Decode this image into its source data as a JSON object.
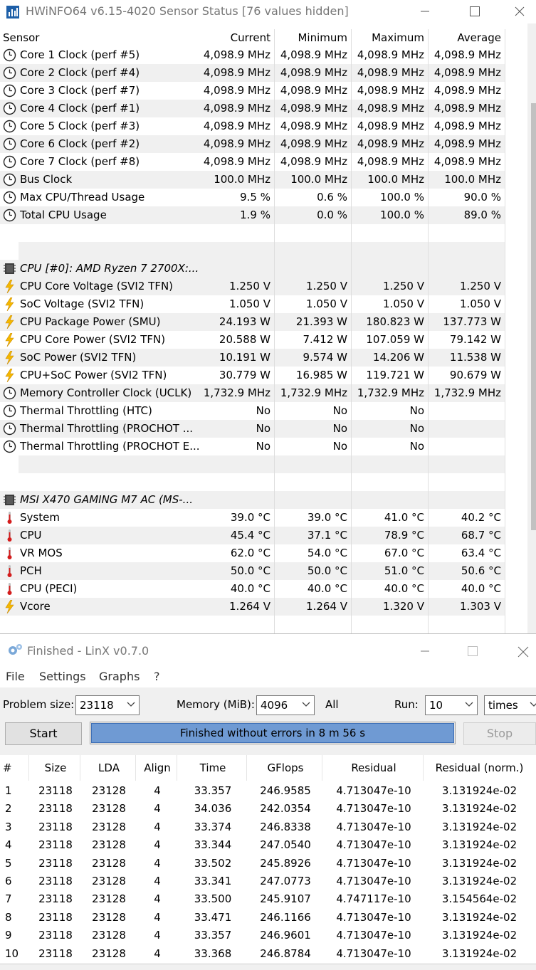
{
  "hwinfo": {
    "title": "HWiNFO64 v6.15-4020 Sensor Status [76 values hidden]",
    "columns": [
      "Sensor",
      "Current",
      "Minimum",
      "Maximum",
      "Average"
    ],
    "rows": [
      {
        "type": "sensor",
        "icon": "clock-icon",
        "label": "Core 1 Clock (perf #5)",
        "cur": "4,098.9 MHz",
        "min": "4,098.9 MHz",
        "max": "4,098.9 MHz",
        "avg": "4,098.9 MHz"
      },
      {
        "type": "sensor",
        "icon": "clock-icon",
        "label": "Core 2 Clock (perf #4)",
        "cur": "4,098.9 MHz",
        "min": "4,098.9 MHz",
        "max": "4,098.9 MHz",
        "avg": "4,098.9 MHz"
      },
      {
        "type": "sensor",
        "icon": "clock-icon",
        "label": "Core 3 Clock (perf #7)",
        "cur": "4,098.9 MHz",
        "min": "4,098.9 MHz",
        "max": "4,098.9 MHz",
        "avg": "4,098.9 MHz"
      },
      {
        "type": "sensor",
        "icon": "clock-icon",
        "label": "Core 4 Clock (perf #1)",
        "cur": "4,098.9 MHz",
        "min": "4,098.9 MHz",
        "max": "4,098.9 MHz",
        "avg": "4,098.9 MHz"
      },
      {
        "type": "sensor",
        "icon": "clock-icon",
        "label": "Core 5 Clock (perf #3)",
        "cur": "4,098.9 MHz",
        "min": "4,098.9 MHz",
        "max": "4,098.9 MHz",
        "avg": "4,098.9 MHz"
      },
      {
        "type": "sensor",
        "icon": "clock-icon",
        "label": "Core 6 Clock (perf #2)",
        "cur": "4,098.9 MHz",
        "min": "4,098.9 MHz",
        "max": "4,098.9 MHz",
        "avg": "4,098.9 MHz"
      },
      {
        "type": "sensor",
        "icon": "clock-icon",
        "label": "Core 7 Clock (perf #8)",
        "cur": "4,098.9 MHz",
        "min": "4,098.9 MHz",
        "max": "4,098.9 MHz",
        "avg": "4,098.9 MHz"
      },
      {
        "type": "sensor",
        "icon": "clock-icon",
        "label": "Bus Clock",
        "cur": "100.0 MHz",
        "min": "100.0 MHz",
        "max": "100.0 MHz",
        "avg": "100.0 MHz"
      },
      {
        "type": "sensor",
        "icon": "clock-icon",
        "label": "Max CPU/Thread Usage",
        "cur": "9.5 %",
        "min": "0.6 %",
        "max": "100.0 %",
        "avg": "90.0 %"
      },
      {
        "type": "sensor",
        "icon": "clock-icon",
        "label": "Total CPU Usage",
        "cur": "1.9 %",
        "min": "0.0 %",
        "max": "100.0 %",
        "avg": "89.0 %"
      },
      {
        "type": "blank"
      },
      {
        "type": "blank"
      },
      {
        "type": "group",
        "icon": "chip-icon",
        "label": "CPU [#0]: AMD Ryzen 7 2700X:..."
      },
      {
        "type": "sensor",
        "icon": "bolt-icon",
        "label": "CPU Core Voltage (SVI2 TFN)",
        "cur": "1.250 V",
        "min": "1.250 V",
        "max": "1.250 V",
        "avg": "1.250 V"
      },
      {
        "type": "sensor",
        "icon": "bolt-icon",
        "label": "SoC Voltage (SVI2 TFN)",
        "cur": "1.050 V",
        "min": "1.050 V",
        "max": "1.050 V",
        "avg": "1.050 V"
      },
      {
        "type": "sensor",
        "icon": "bolt-icon",
        "label": "CPU Package Power (SMU)",
        "cur": "24.193 W",
        "min": "21.393 W",
        "max": "180.823 W",
        "avg": "137.773 W"
      },
      {
        "type": "sensor",
        "icon": "bolt-icon",
        "label": "CPU Core Power (SVI2 TFN)",
        "cur": "20.588 W",
        "min": "7.412 W",
        "max": "107.059 W",
        "avg": "79.142 W"
      },
      {
        "type": "sensor",
        "icon": "bolt-icon",
        "label": "SoC Power (SVI2 TFN)",
        "cur": "10.191 W",
        "min": "9.574 W",
        "max": "14.206 W",
        "avg": "11.538 W"
      },
      {
        "type": "sensor",
        "icon": "bolt-icon",
        "label": "CPU+SoC Power (SVI2 TFN)",
        "cur": "30.779 W",
        "min": "16.985 W",
        "max": "119.721 W",
        "avg": "90.679 W"
      },
      {
        "type": "sensor",
        "icon": "clock-icon",
        "label": "Memory Controller Clock (UCLK)",
        "cur": "1,732.9 MHz",
        "min": "1,732.9 MHz",
        "max": "1,732.9 MHz",
        "avg": "1,732.9 MHz"
      },
      {
        "type": "sensor",
        "icon": "clock-icon",
        "label": "Thermal Throttling (HTC)",
        "cur": "No",
        "min": "No",
        "max": "No",
        "avg": ""
      },
      {
        "type": "sensor",
        "icon": "clock-icon",
        "label": "Thermal Throttling (PROCHOT ...",
        "cur": "No",
        "min": "No",
        "max": "No",
        "avg": ""
      },
      {
        "type": "sensor",
        "icon": "clock-icon",
        "label": "Thermal Throttling (PROCHOT E...",
        "cur": "No",
        "min": "No",
        "max": "No",
        "avg": ""
      },
      {
        "type": "blank"
      },
      {
        "type": "blank"
      },
      {
        "type": "group",
        "icon": "chip-icon",
        "label": "MSI X470 GAMING M7 AC (MS-..."
      },
      {
        "type": "sensor",
        "icon": "thermometer-icon",
        "label": "System",
        "cur": "39.0 °C",
        "min": "39.0 °C",
        "max": "41.0 °C",
        "avg": "40.2 °C"
      },
      {
        "type": "sensor",
        "icon": "thermometer-icon",
        "label": "CPU",
        "cur": "45.4 °C",
        "min": "37.1 °C",
        "max": "78.9 °C",
        "avg": "68.7 °C"
      },
      {
        "type": "sensor",
        "icon": "thermometer-icon",
        "label": "VR MOS",
        "cur": "62.0 °C",
        "min": "54.0 °C",
        "max": "67.0 °C",
        "avg": "63.4 °C"
      },
      {
        "type": "sensor",
        "icon": "thermometer-icon",
        "label": "PCH",
        "cur": "50.0 °C",
        "min": "50.0 °C",
        "max": "51.0 °C",
        "avg": "50.6 °C"
      },
      {
        "type": "sensor",
        "icon": "thermometer-icon",
        "label": "CPU (PECI)",
        "cur": "40.0 °C",
        "min": "40.0 °C",
        "max": "40.0 °C",
        "avg": "40.0 °C"
      },
      {
        "type": "sensor",
        "icon": "bolt-icon",
        "label": "Vcore",
        "cur": "1.264 V",
        "min": "1.264 V",
        "max": "1.320 V",
        "avg": "1.303 V"
      }
    ]
  },
  "linx": {
    "title": "Finished - LinX v0.7.0",
    "menu": [
      "File",
      "Settings",
      "Graphs",
      "?"
    ],
    "problem_size_label": "Problem size:",
    "problem_size": "23118",
    "memory_label": "Memory (MiB):",
    "memory": "4096",
    "all_label": "All",
    "run_label": "Run:",
    "run": "10",
    "run_unit": "times",
    "start_label": "Start",
    "stop_label": "Stop",
    "progress_text": "Finished without errors in 8 m 56 s",
    "progress_fraction": 1.0,
    "columns": [
      "#",
      "Size",
      "LDA",
      "Align",
      "Time",
      "GFlops",
      "Residual",
      "Residual (norm.)"
    ],
    "rows": [
      [
        "1",
        "23118",
        "23128",
        "4",
        "33.357",
        "246.9585",
        "4.713047e-10",
        "3.131924e-02"
      ],
      [
        "2",
        "23118",
        "23128",
        "4",
        "34.036",
        "242.0354",
        "4.713047e-10",
        "3.131924e-02"
      ],
      [
        "3",
        "23118",
        "23128",
        "4",
        "33.374",
        "246.8338",
        "4.713047e-10",
        "3.131924e-02"
      ],
      [
        "4",
        "23118",
        "23128",
        "4",
        "33.344",
        "247.0540",
        "4.713047e-10",
        "3.131924e-02"
      ],
      [
        "5",
        "23118",
        "23128",
        "4",
        "33.502",
        "245.8926",
        "4.713047e-10",
        "3.131924e-02"
      ],
      [
        "6",
        "23118",
        "23128",
        "4",
        "33.341",
        "247.0773",
        "4.713047e-10",
        "3.131924e-02"
      ],
      [
        "7",
        "23118",
        "23128",
        "4",
        "33.500",
        "245.9107",
        "4.747117e-10",
        "3.154564e-02"
      ],
      [
        "8",
        "23118",
        "23128",
        "4",
        "33.471",
        "246.1166",
        "4.713047e-10",
        "3.131924e-02"
      ],
      [
        "9",
        "23118",
        "23128",
        "4",
        "33.357",
        "246.9601",
        "4.713047e-10",
        "3.131924e-02"
      ],
      [
        "10",
        "23118",
        "23128",
        "4",
        "33.368",
        "246.8784",
        "4.713047e-10",
        "3.131924e-02"
      ]
    ]
  }
}
